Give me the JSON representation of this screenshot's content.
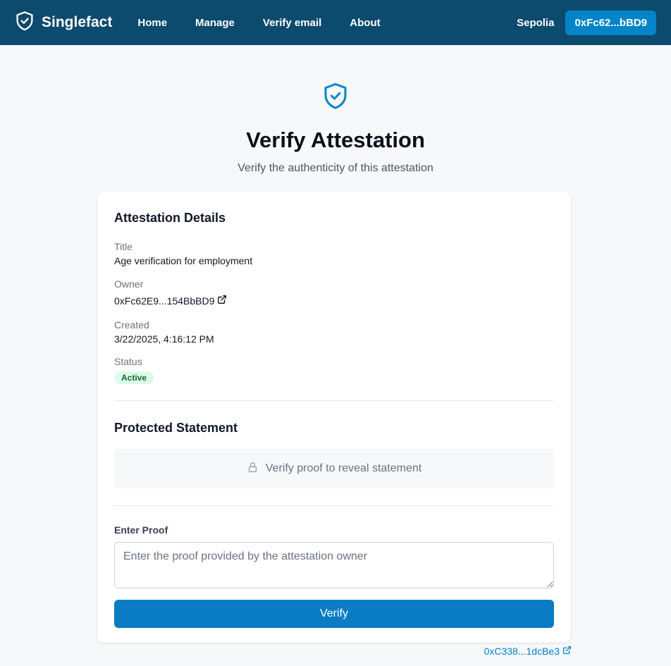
{
  "nav": {
    "brand": "Singlefact",
    "links": [
      "Home",
      "Manage",
      "Verify email",
      "About"
    ],
    "network": "Sepolia",
    "wallet": "0xFc62...bBD9"
  },
  "hero": {
    "icon": "shield-check-icon",
    "title": "Verify Attestation",
    "subtitle": "Verify the authenticity of this attestation"
  },
  "details": {
    "heading": "Attestation Details",
    "title_label": "Title",
    "title_value": "Age verification for employment",
    "owner_label": "Owner",
    "owner_value": "0xFc62E9...154BbBD9",
    "created_label": "Created",
    "created_value": "3/22/2025, 4:16:12 PM",
    "status_label": "Status",
    "status_value": "Active"
  },
  "protected": {
    "heading": "Protected Statement",
    "locked_text": "Verify proof to reveal statement"
  },
  "proof": {
    "label": "Enter Proof",
    "value": "",
    "placeholder": "Enter the proof provided by the attestation owner",
    "button": "Verify"
  },
  "footer": {
    "contract": "0xC338...1dcBe3"
  },
  "colors": {
    "navbar": "#0c4a6e",
    "accent": "#0284c7",
    "verify_button": "#0a7cc4",
    "status_bg": "#dcfce7",
    "status_text": "#166534"
  }
}
